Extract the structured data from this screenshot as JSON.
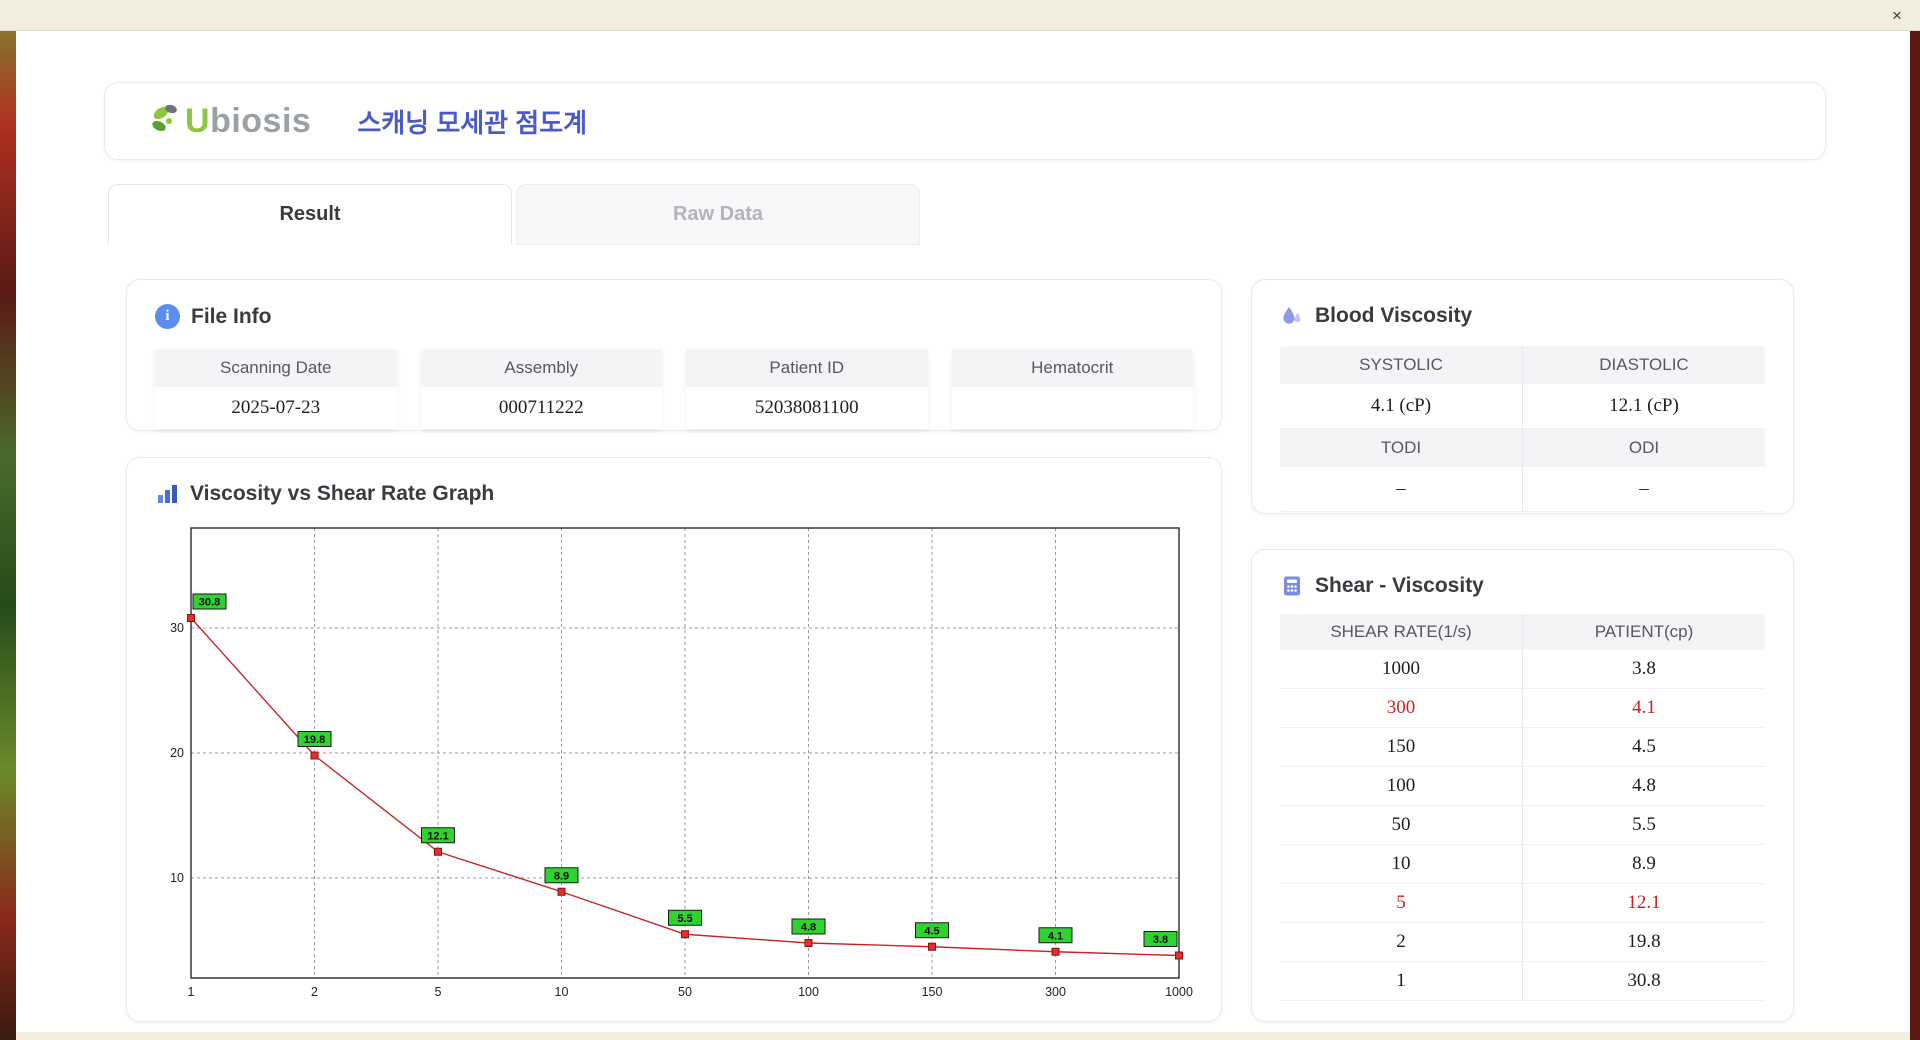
{
  "window": {
    "close_label": "×"
  },
  "icons": {
    "info_glyph": "i"
  },
  "header": {
    "logo_u": "U",
    "logo_rest": "biosis",
    "title": "스캐닝 모세관 점도계"
  },
  "tabs": [
    {
      "label": "Result",
      "active": true
    },
    {
      "label": "Raw Data",
      "active": false
    }
  ],
  "file_info": {
    "title": "File Info",
    "fields": [
      {
        "label": "Scanning Date",
        "value": "2025-07-23"
      },
      {
        "label": "Assembly",
        "value": "000711222"
      },
      {
        "label": "Patient ID",
        "value": "52038081100"
      },
      {
        "label": "Hematocrit",
        "value": ""
      }
    ]
  },
  "graph": {
    "title": "Viscosity vs Shear Rate Graph"
  },
  "blood_viscosity": {
    "title": "Blood Viscosity",
    "row1": [
      {
        "header": "SYSTOLIC",
        "value": "4.1 (cP)"
      },
      {
        "header": "DIASTOLIC",
        "value": "12.1 (cP)"
      }
    ],
    "row2": [
      {
        "header": "TODI",
        "value": "–"
      },
      {
        "header": "ODI",
        "value": "–"
      }
    ]
  },
  "shear_table": {
    "title": "Shear - Viscosity",
    "headers": [
      "SHEAR RATE(1/s)",
      "PATIENT(cp)"
    ],
    "rows": [
      {
        "rate": "1000",
        "patient": "3.8",
        "highlight": false
      },
      {
        "rate": "300",
        "patient": "4.1",
        "highlight": true
      },
      {
        "rate": "150",
        "patient": "4.5",
        "highlight": false
      },
      {
        "rate": "100",
        "patient": "4.8",
        "highlight": false
      },
      {
        "rate": "50",
        "patient": "5.5",
        "highlight": false
      },
      {
        "rate": "10",
        "patient": "8.9",
        "highlight": false
      },
      {
        "rate": "5",
        "patient": "12.1",
        "highlight": true
      },
      {
        "rate": "2",
        "patient": "19.8",
        "highlight": false
      },
      {
        "rate": "1",
        "patient": "30.8",
        "highlight": false
      }
    ]
  },
  "chart_data": {
    "type": "line",
    "title": "Viscosity vs Shear Rate Graph",
    "x": [
      "1",
      "2",
      "5",
      "10",
      "50",
      "100",
      "150",
      "300",
      "1000"
    ],
    "values": [
      30.8,
      19.8,
      12.1,
      8.9,
      5.5,
      4.8,
      4.5,
      4.1,
      3.8
    ],
    "xlabel": "",
    "ylabel": "",
    "x_scale": "categorical",
    "yticks": [
      10,
      20,
      30
    ],
    "ylim": [
      2,
      38
    ],
    "grid": "dashed",
    "line_color": "#c42626",
    "marker_color": "#e02f2f",
    "marker_border": "#8f0f0f",
    "label_bg": "#2ed32e",
    "label_border": "#1a1a1a"
  }
}
